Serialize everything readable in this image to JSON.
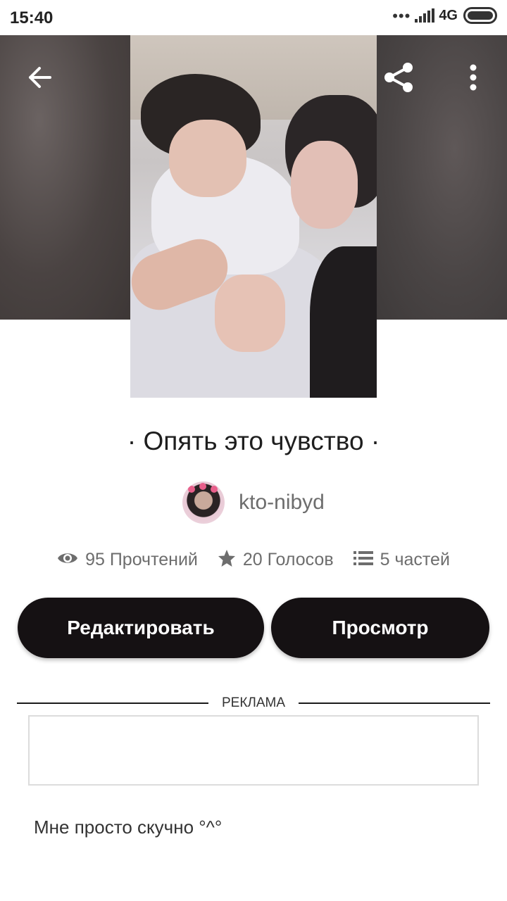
{
  "status_bar": {
    "time": "15:40",
    "network": "4G",
    "icons": [
      "more-dots-icon",
      "signal-icon",
      "battery-icon"
    ]
  },
  "toolbar": {
    "back_icon": "arrow-left-icon",
    "share_icon": "share-icon",
    "menu_icon": "more-vertical-icon"
  },
  "story": {
    "title": "· Опять это чувство ·",
    "author": "kto-nibyd",
    "description": "Мне просто скучно °^°"
  },
  "stats": {
    "reads": "95 Прочтений",
    "votes": "20 Голосов",
    "parts": "5 частей"
  },
  "actions": {
    "edit_label": "Редактировать",
    "view_label": "Просмотр"
  },
  "ad": {
    "label": "РЕКЛАМА"
  },
  "colors": {
    "button_bg": "#151113",
    "button_text": "#ffffff",
    "muted_text": "#6d6d6d"
  }
}
